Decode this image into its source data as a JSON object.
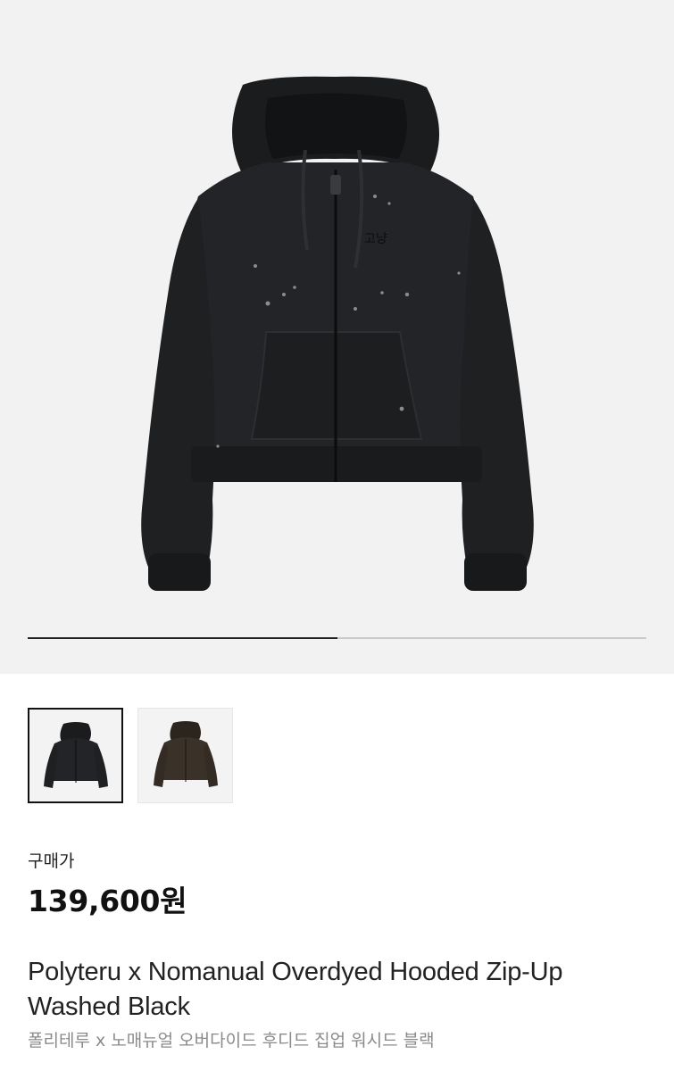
{
  "gallery": {
    "main_image": "Black washed zip-up hoodie product photo",
    "progress_fraction": 0.5,
    "thumbnails": [
      {
        "name": "washed-black-hoodie",
        "selected": true
      },
      {
        "name": "washed-brown-hoodie",
        "selected": false
      }
    ]
  },
  "price": {
    "label": "구매가",
    "value": "139,600원"
  },
  "product": {
    "title_en": "Polyteru x Nomanual Overdyed Hooded Zip-Up Washed Black",
    "title_ko": "폴리테루 x 노매뉴얼 오버다이드 후디드 집업 워시드 블랙"
  },
  "colors": {
    "hero_bg": "#f2f2f2",
    "hoodie_black": "#1e1f21",
    "hoodie_brown": "#3a3128",
    "progress_active": "#222222",
    "progress_track": "#c9c9c9"
  }
}
